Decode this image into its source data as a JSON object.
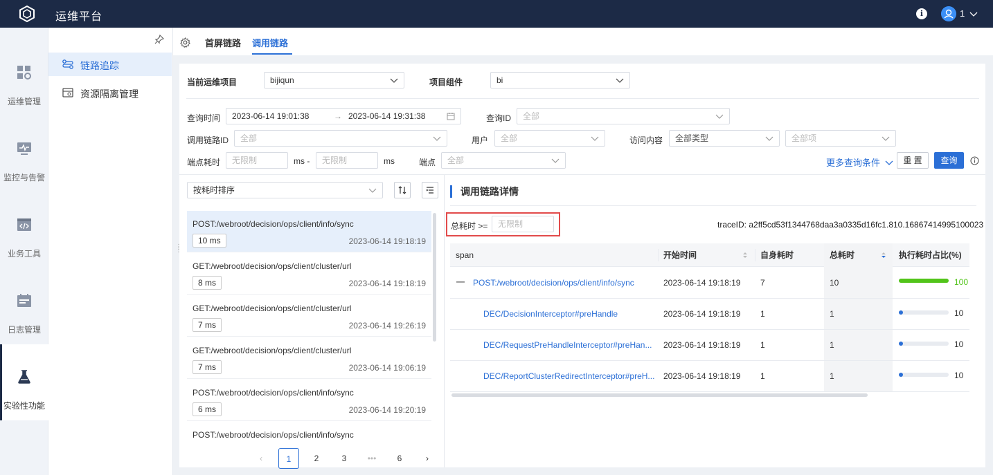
{
  "app": {
    "title": "运维平台",
    "user": "1"
  },
  "left_nav": [
    {
      "label": "运维管理"
    },
    {
      "label": "监控与告警"
    },
    {
      "label": "业务工具"
    },
    {
      "label": "日志管理"
    },
    {
      "label": "实验性功能",
      "active": true
    }
  ],
  "side_nav": [
    {
      "label": "链路追踪",
      "active": true
    },
    {
      "label": "资源隔离管理"
    }
  ],
  "tabs": [
    {
      "label": "首屏链路"
    },
    {
      "label": "调用链路",
      "active": true
    }
  ],
  "project": {
    "label": "当前运维项目",
    "value": "bijiqun",
    "component_label": "项目组件",
    "component_value": "bi"
  },
  "filters": {
    "query_time_label": "查询时间",
    "time_start": "2023-06-14 19:01:38",
    "time_arrow": "→",
    "time_end": "2023-06-14 19:31:38",
    "query_id_label": "查询ID",
    "query_id_ph": "全部",
    "trace_id_label": "调用链路ID",
    "trace_id_ph": "全部",
    "user_label": "用户",
    "user_ph": "全部",
    "visit_label": "访问内容",
    "visit_type": "全部类型",
    "visit_item_ph": "全部项",
    "cost_label": "端点耗时",
    "cost_min_ph": "无限制",
    "ms_dash": "ms -",
    "cost_max_ph": "无限制",
    "ms": "ms",
    "endpoint_label": "端点",
    "endpoint_ph": "全部",
    "more_label": "更多查询条件",
    "reset_label": "重 置",
    "query_label": "查询"
  },
  "list": {
    "sort_label": "按耗时排序",
    "items": [
      {
        "title": "POST:/webroot/decision/ops/client/info/sync",
        "cost": "10 ms",
        "time": "2023-06-14 19:18:19",
        "active": true
      },
      {
        "title": "GET:/webroot/decision/ops/client/cluster/url",
        "cost": "8 ms",
        "time": "2023-06-14 19:18:19"
      },
      {
        "title": "GET:/webroot/decision/ops/client/cluster/url",
        "cost": "7 ms",
        "time": "2023-06-14 19:26:19"
      },
      {
        "title": "GET:/webroot/decision/ops/client/cluster/url",
        "cost": "7 ms",
        "time": "2023-06-14 19:06:19"
      },
      {
        "title": "POST:/webroot/decision/ops/client/info/sync",
        "cost": "6 ms",
        "time": "2023-06-14 19:20:19"
      },
      {
        "title": "POST:/webroot/decision/ops/client/info/sync",
        "cost": "",
        "time": ""
      }
    ],
    "pages": [
      "1",
      "2",
      "3",
      "•••",
      "6"
    ]
  },
  "detail": {
    "title": "调用链路详情",
    "total_filter_label": "总耗时 >=",
    "total_filter_ph": "无限制",
    "trace_prefix": "traceID: a2ff5cd53f1344768daa3a0335d16fc1.810.16867414995100023",
    "columns": [
      "span",
      "开始时间",
      "自身耗时",
      "总耗时",
      "执行耗时占比(%)"
    ],
    "rows": [
      {
        "collapse": "—",
        "span": "POST:/webroot/decision/ops/client/info/sync",
        "start": "2023-06-14 19:18:19",
        "self": "7",
        "total": "10",
        "pct": 100,
        "pct_label": "100",
        "bar_color": "#52c41a",
        "label_color": "#52c41a"
      },
      {
        "span": "DEC/DecisionInterceptor#preHandle",
        "start": "2023-06-14 19:18:19",
        "self": "1",
        "total": "1",
        "pct": 10,
        "pct_label": "10",
        "bar_color": "#2b6fd6",
        "label_color": "#333333"
      },
      {
        "span": "DEC/RequestPreHandleInterceptor#preHan...",
        "start": "2023-06-14 19:18:19",
        "self": "1",
        "total": "1",
        "pct": 10,
        "pct_label": "10",
        "bar_color": "#2b6fd6",
        "label_color": "#333333"
      },
      {
        "span": "DEC/ReportClusterRedirectInterceptor#preH...",
        "start": "2023-06-14 19:18:19",
        "self": "1",
        "total": "1",
        "pct": 10,
        "pct_label": "10",
        "bar_color": "#2b6fd6",
        "label_color": "#333333"
      }
    ]
  }
}
